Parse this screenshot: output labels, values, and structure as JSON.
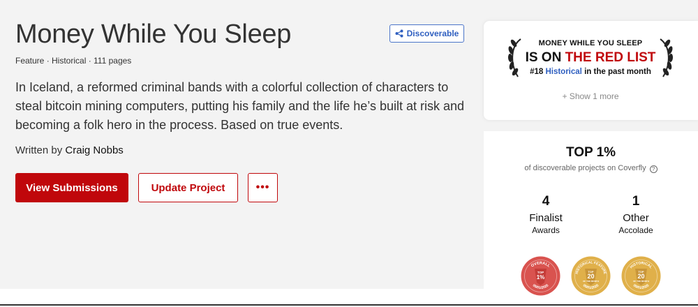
{
  "project": {
    "title": "Money While You Sleep",
    "meta": "Feature · Historical · 111 pages",
    "logline": "In Iceland, a reformed criminal bands with a colorful collection of characters to steal bitcoin mining computers, putting his family and the life he’s built at risk and becoming a folk hero in the process. Based on true events.",
    "written_by_label": "Written by",
    "writer": "Craig Nobbs"
  },
  "actions": {
    "view_submissions": "View Submissions",
    "update_project": "Update Project",
    "more": "•••",
    "discoverable": "Discoverable"
  },
  "red_list": {
    "line1": "MONEY WHILE YOU SLEEP",
    "line2_prefix": "IS ON",
    "line2_highlight": "THE RED LIST",
    "rank": "#18",
    "genre": "Historical",
    "period": "in the past month",
    "show_more": "+ Show 1 more"
  },
  "stats": {
    "top_pct": "TOP 1%",
    "top_desc": "of discoverable projects on Coverfly",
    "help_icon": "?",
    "finalist_count": "4",
    "finalist_label": "Finalist",
    "finalist_sub": "Awards",
    "other_count": "1",
    "other_label": "Other",
    "other_sub": "Accolade"
  },
  "badges": [
    {
      "top": "OVERALL",
      "mid1": "TOP",
      "mid2": "1%",
      "date": "05/01/2025",
      "color": "#d9534f"
    },
    {
      "top": "HISTORICAL FEATURE",
      "mid1": "TOP",
      "mid2": "20",
      "mid3": "OF THE MONTH",
      "date": "05/01/2025",
      "color": "#e0b04a"
    },
    {
      "top": "HISTORICAL",
      "mid1": "TOP",
      "mid2": "20",
      "mid3": "OF THE MONTH",
      "date": "05/01/2025",
      "color": "#e0b04a"
    }
  ],
  "colors": {
    "accent_red": "#c0070b",
    "link_blue": "#2f5fc0",
    "badge_red": "#d9534f",
    "badge_gold": "#e0b04a"
  }
}
